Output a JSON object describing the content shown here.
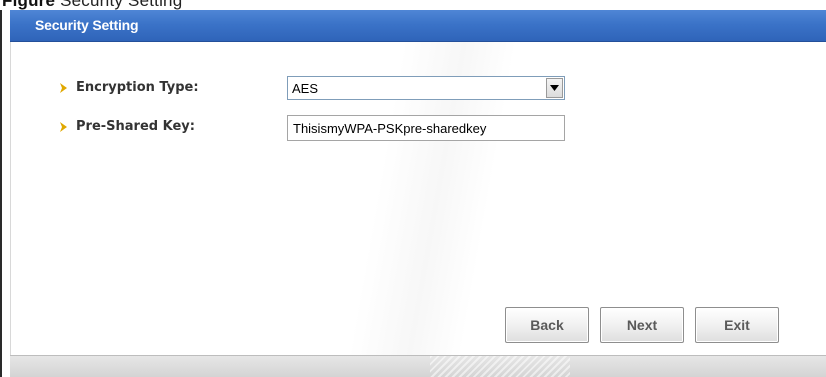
{
  "caption": {
    "prefix": "Figure",
    "text": "Security Setting"
  },
  "window": {
    "title": "Security Setting"
  },
  "form": {
    "encryption_type": {
      "label": "Encryption Type:",
      "value": "AES"
    },
    "pre_shared_key": {
      "label": "Pre-Shared Key:",
      "value": "ThisismyWPA-PSKpre-sharedkey"
    }
  },
  "buttons": {
    "back": "Back",
    "next": "Next",
    "exit": "Exit"
  },
  "colors": {
    "title_bar": "#3b73c8",
    "label_arrow": "#e0a800",
    "label_text": "#333333"
  },
  "icons": {
    "label_marker": "chevron-right-icon",
    "dropdown": "chevron-down-icon"
  }
}
